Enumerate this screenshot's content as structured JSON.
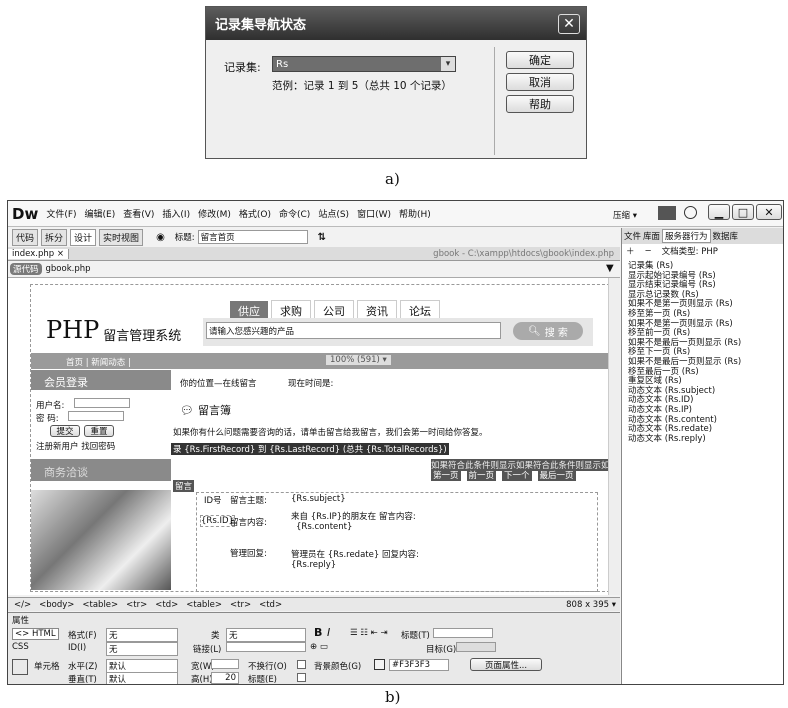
{
  "dialog": {
    "title": "记录集导航状态",
    "recordset_label": "记录集:",
    "recordset_value": "Rs",
    "example": "范例：记录 1 到 5（总共 10 个记录）",
    "ok": "确定",
    "cancel": "取消",
    "help": "帮助"
  },
  "captions": {
    "a": "a)",
    "b": "b)"
  },
  "dw": {
    "logo": "Dw",
    "menus": [
      "文件(F)",
      "编辑(E)",
      "查看(V)",
      "插入(I)",
      "修改(M)",
      "格式(O)",
      "命令(C)",
      "站点(S)",
      "窗口(W)",
      "帮助(H)"
    ],
    "compress": "压缩 ▾",
    "toolbar": {
      "code": "代码",
      "split": "拆分",
      "design": "设计",
      "live": "实时视图",
      "title_label": "标题:",
      "title_value": "留言首页"
    },
    "tab": "index.php",
    "path": "gbook - C:\\xampp\\htdocs\\gbook\\index.php",
    "source_tag": "源代码",
    "source_file": "gbook.php",
    "page": {
      "logo_php": "PHP",
      "logo_rest": "留言管理系统",
      "nav_tabs": [
        "供应",
        "求购",
        "公司",
        "资讯",
        "论坛"
      ],
      "search_placeholder": "请输入您感兴趣的产品",
      "search_btn": "搜 索",
      "topnav": "首页 | 新闻动态 |",
      "ruler": "100% (591) ▾",
      "member_login": "会员登录",
      "username": "用户名:",
      "password": "密  码:",
      "submit": "提交",
      "reset": "重置",
      "register": "注册新用户 找回密码",
      "location": "你的位置—在线留言",
      "time_label": "现在时间是:",
      "board_title": "留言簿",
      "intro": "如果你有什么问题需要咨询的话，请单击留言给我留言，我们会第一时间给你答复。",
      "recordbar": "录 {Rs.FirstRecord} 到 {Rs.LastRecord} (总共 {Rs.TotalRecords})",
      "if_text": "如果符合此条件则显示如果符合此条件则显示如果符合此条件则显示如果符合",
      "nav_links": [
        "第一页",
        "前一页",
        "下一个",
        "最后一页"
      ],
      "service": "商务洽谈",
      "hdr_tag": "留言",
      "id_label": "ID号",
      "subject_label": "留言主题:",
      "subject_val": "{Rs.subject}",
      "rsid": "{Rs.ID}",
      "content_label": "留言内容:",
      "content_from": "来自 {Rs.IP}的朋友在 留言内容:",
      "content_val": "{Rs.content}",
      "reply_label": "管理回复:",
      "reply_by": "管理员在 {Rs.redate} 回复内容:",
      "reply_val": "{Rs.reply}"
    },
    "statusbar": {
      "tags": [
        "<body>",
        "<table>",
        "<tr>",
        "<td>",
        "<table>",
        "<tr>",
        "<td>"
      ],
      "size": "808 x 395 ▾"
    },
    "props": {
      "title": "属性",
      "html": "<> HTML",
      "css": "CSS",
      "format_label": "格式(F)",
      "format_val": "无",
      "class_label": "类",
      "class_val": "无",
      "id_label": "ID(I)",
      "id_val": "无",
      "link_label": "链接(L)",
      "title_label": "标题(T)",
      "target_label": "目标(G)",
      "cell_label": "单元格",
      "horz_label": "水平(Z)",
      "horz_val": "默认",
      "vert_label": "垂直(T)",
      "vert_val": "默认",
      "width_label": "宽(W)",
      "height_label": "高(H)",
      "height_val": "20",
      "nowrap_label": "不换行(O)",
      "header_label": "标题(E)",
      "bg_label": "背景颜色(G)",
      "bg_val": "#F3F3F3",
      "page_props": "页面属性..."
    },
    "panel": {
      "tabs": [
        "文件",
        "库面",
        "服务器行为",
        "数据库"
      ],
      "doc_type": "文档类型: PHP",
      "items": [
        "记录集 (Rs)",
        "显示起始记录编号 (Rs)",
        "显示结束记录编号 (Rs)",
        "显示总记录数 (Rs)",
        "如果不是第一页则显示 (Rs)",
        "移至第一页 (Rs)",
        "如果不是第一页则显示 (Rs)",
        "移至前一页 (Rs)",
        "如果不是最后一页则显示 (Rs)",
        "移至下一页 (Rs)",
        "如果不是最后一页则显示 (Rs)",
        "移至最后一页 (Rs)",
        "重复区域 (Rs)",
        "动态文本 (Rs.subject)",
        "动态文本 (Rs.ID)",
        "动态文本 (Rs.IP)",
        "动态文本 (Rs.content)",
        "动态文本 (Rs.redate)",
        "动态文本 (Rs.reply)"
      ]
    }
  }
}
